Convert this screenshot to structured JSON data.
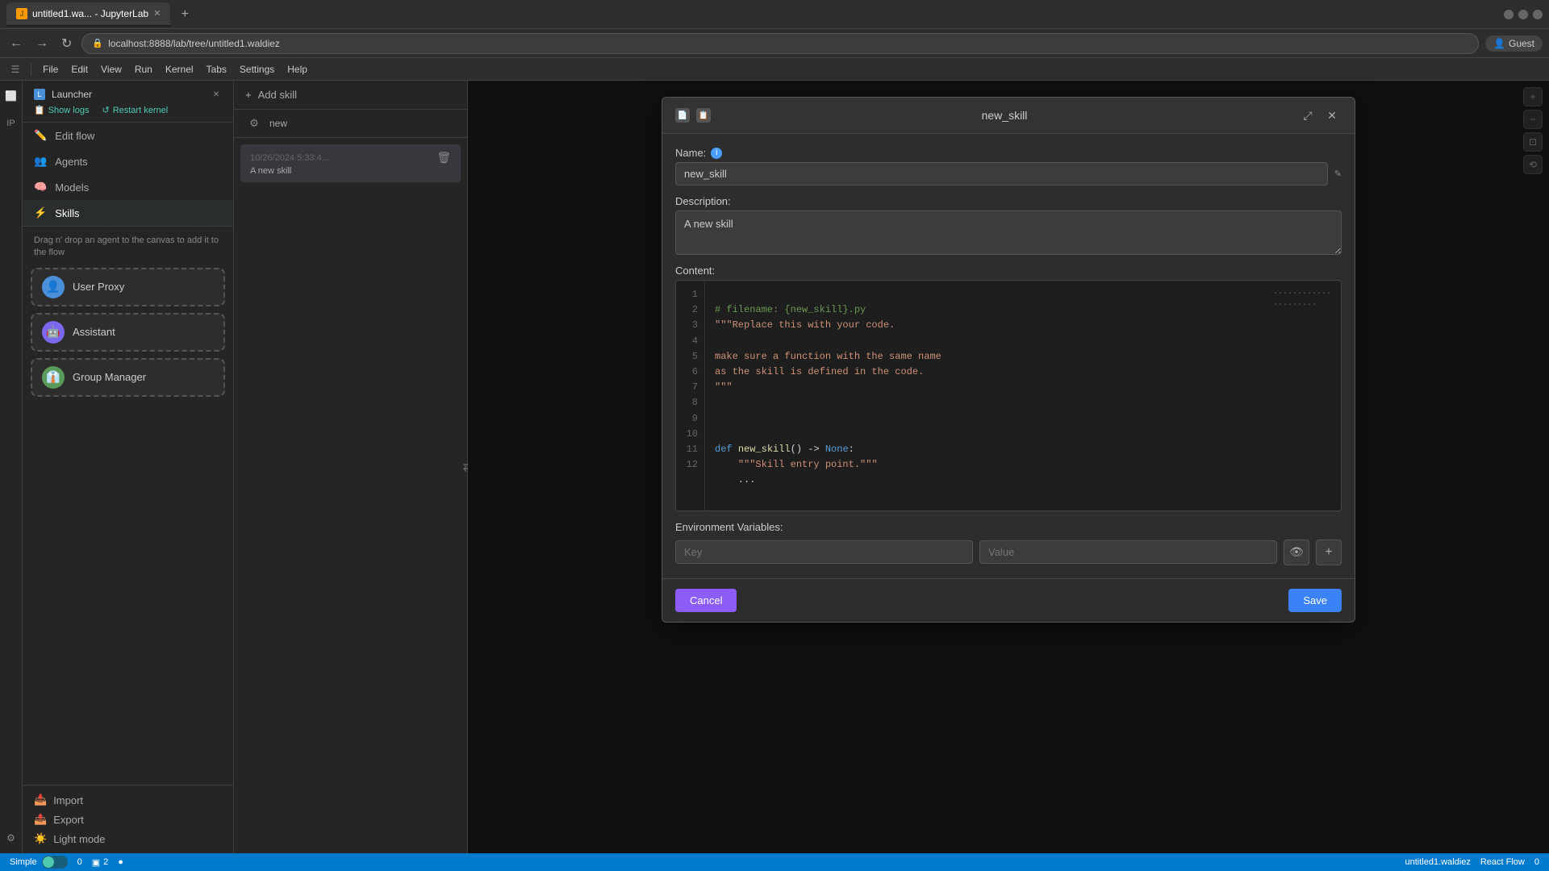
{
  "browser": {
    "tab1_label": "untitled1.wa... - JupyterLab",
    "tab1_favicon": "J",
    "address": "localhost:8888/lab/tree/untitled1.waldiez",
    "guest_label": "Guest"
  },
  "menubar": {
    "items": [
      "File",
      "Edit",
      "View",
      "Run",
      "Kernel",
      "Tabs",
      "Settings",
      "Help"
    ]
  },
  "left_panel": {
    "show_logs": "Show logs",
    "restart_kernel": "Restart kernel",
    "nav_items": [
      {
        "id": "edit-flow",
        "label": "Edit flow",
        "icon": "✏️"
      },
      {
        "id": "agents",
        "label": "Agents",
        "icon": "👥"
      },
      {
        "id": "models",
        "label": "Models",
        "icon": "🧠"
      },
      {
        "id": "skills",
        "label": "Skills",
        "icon": "⚡"
      }
    ],
    "drag_hint": "Drag n' drop an agent to the canvas to add it to the flow",
    "agents": [
      {
        "id": "user-proxy",
        "name": "User Proxy",
        "type": "user"
      },
      {
        "id": "assistant",
        "name": "Assistant",
        "type": "assistant"
      },
      {
        "id": "group-manager",
        "name": "Group Manager",
        "type": "manager"
      }
    ],
    "import_label": "Import",
    "export_label": "Export",
    "light_mode_label": "Light mode"
  },
  "skills_panel": {
    "add_skill_label": "Add skill",
    "settings_icon": "⚙",
    "skill_name_preview": "new",
    "skill_date": "10/26/2024 5:33:4...",
    "skill_description": "A new skill",
    "delete_icon": "🗑"
  },
  "modal": {
    "title": "new_skill",
    "name_label": "Name:",
    "name_value": "new_skill",
    "description_label": "Description:",
    "description_value": "A new skill",
    "content_label": "Content:",
    "code_lines": [
      {
        "num": "1",
        "code": "# filename: {new_skill}.py"
      },
      {
        "num": "2",
        "code": "\"\"\"Replace this with your code."
      },
      {
        "num": "3",
        "code": ""
      },
      {
        "num": "4",
        "code": "make sure a function with the same name"
      },
      {
        "num": "5",
        "code": "as the skill is defined in the code."
      },
      {
        "num": "6",
        "code": "\"\"\""
      },
      {
        "num": "7",
        "code": ""
      },
      {
        "num": "8",
        "code": ""
      },
      {
        "num": "9",
        "code": "def new_skill() -> None:"
      },
      {
        "num": "10",
        "code": "    \"\"\"Skill entry point.\"\"\""
      },
      {
        "num": "11",
        "code": "    ..."
      },
      {
        "num": "12",
        "code": ""
      }
    ],
    "env_vars_label": "Environment Variables:",
    "key_placeholder": "Key",
    "value_placeholder": "Value",
    "cancel_label": "Cancel",
    "save_label": "Save"
  },
  "statusbar": {
    "simple_label": "Simple",
    "tab_count": "0",
    "file_count": "2",
    "file_name": "untitled1.waldiez",
    "reactflow_label": "React Flow",
    "zoom_label": "0"
  }
}
